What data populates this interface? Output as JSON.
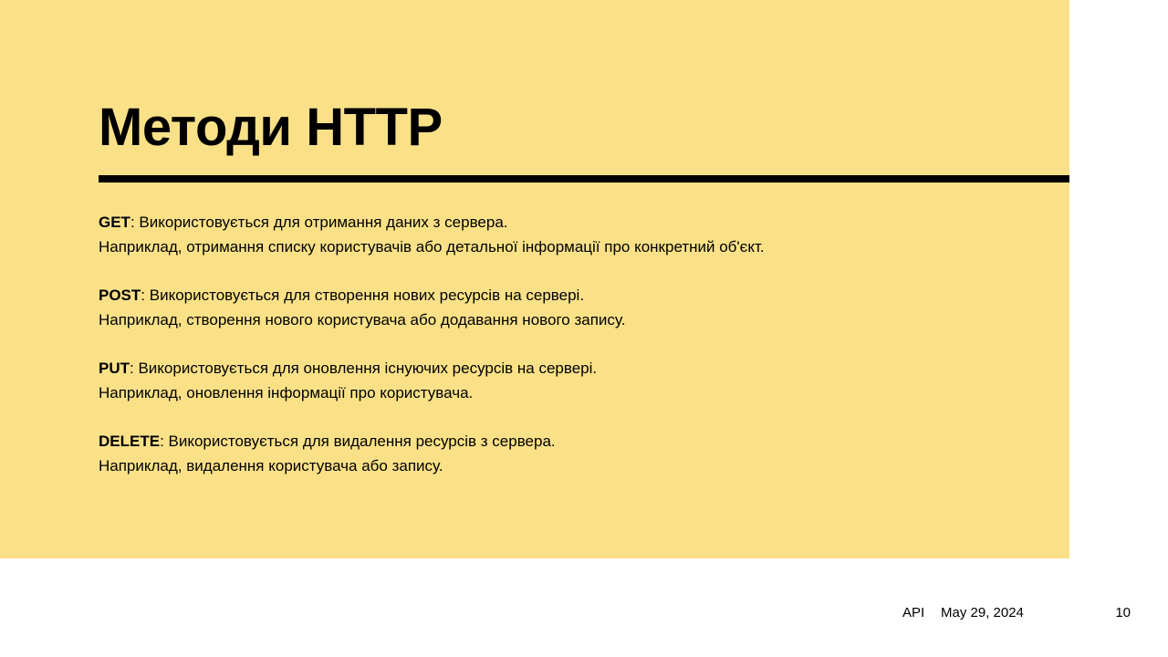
{
  "slide": {
    "title": "Методи HTTP",
    "colors": {
      "panel_background": "#fae187",
      "rule": "#000000",
      "text": "#000000",
      "page_background": "#ffffff"
    },
    "methods": [
      {
        "name": "GET",
        "separator": ": ",
        "description": "Використовується для отримання даних з сервера.",
        "example": "Наприклад, отримання списку користувачів або детальної інформації про конкретний об'єкт."
      },
      {
        "name": "POST",
        "separator": ": ",
        "description": "Використовується для створення нових ресурсів на сервері.",
        "example": "Наприклад, створення нового користувача або додавання нового запису."
      },
      {
        "name": "PUT",
        "separator": ": ",
        "description": "Використовується для оновлення існуючих ресурсів на сервері.",
        "example": "Наприклад, оновлення інформації про користувача."
      },
      {
        "name": "DELETE",
        "separator": ": ",
        "description": "Використовується для видалення ресурсів з сервера.",
        "example": "Наприклад, видалення користувача або запису."
      }
    ]
  },
  "footer": {
    "title": "API",
    "date": "May 29, 2024",
    "page_number": "10"
  }
}
